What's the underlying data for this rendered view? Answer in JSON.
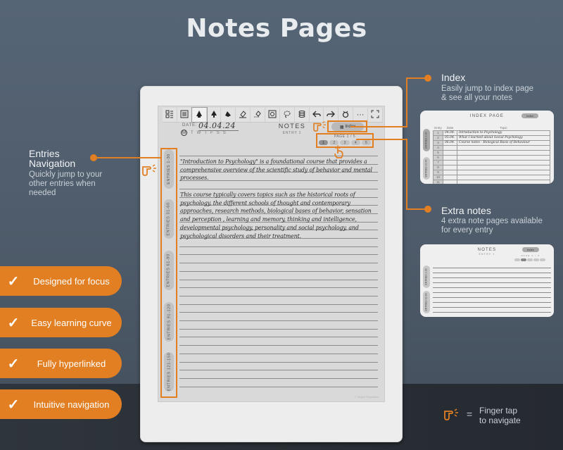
{
  "title": "Notes Pages",
  "device": {
    "toolbar": [
      {
        "icon": "layout-grid-icon"
      },
      {
        "icon": "list-icon"
      },
      {
        "icon": "pen-tool-icon",
        "active": true
      },
      {
        "icon": "brush-icon"
      },
      {
        "icon": "marker-icon"
      },
      {
        "icon": "eraser-icon"
      },
      {
        "icon": "selection-eraser-icon"
      },
      {
        "icon": "screenshot-icon"
      },
      {
        "icon": "lasso-icon"
      },
      {
        "icon": "layers-icon"
      },
      {
        "icon": "undo-icon"
      },
      {
        "icon": "redo-icon"
      },
      {
        "icon": "ai-assistant-icon"
      },
      {
        "icon": "more-icon",
        "glyph": "···"
      },
      {
        "icon": "fullscreen-icon"
      }
    ],
    "date_label": "DATE:",
    "date_value": "04.04.24",
    "weekdays": [
      "M",
      "T",
      "W",
      "T",
      "F",
      "S",
      "S"
    ],
    "notes_title": "NOTES",
    "entry_label": "ENTRY 1",
    "index_button": "Index",
    "page_label": "PAGE 1 / 5",
    "pages": [
      "1",
      "2",
      "3",
      "4",
      "5"
    ],
    "current_page": 1,
    "side_tabs": [
      "ENTRIES 1-30",
      "ENTRIES 31-60",
      "ENTRIES 61-90",
      "ENTRIES 91-120",
      "ENTRIES 121-150"
    ],
    "paragraphs": [
      "\"Introduction to Psychology\" is a foundational course that provides a comprehensive overview of the scientific study of behavior and mental processes.",
      "This course typically covers topics such as the historical roots of psychology, the different schools of thought and contemporary approaches, research methods, biological bases of behavior, sensation and perception , learning and memory, thinking and intelligence, developmental psychology, personality and social psychology, and psychological disorders and their treatment."
    ],
    "copyright": "© Digital Templates"
  },
  "annotations": {
    "entries_nav": {
      "title_line1": "Entries",
      "title_line2": "Navigation",
      "desc": [
        "Quickly jump to your",
        "other entries when",
        "needed"
      ]
    },
    "index": {
      "title": "Index",
      "desc": [
        "Easily jump to index page",
        "& see all your notes"
      ]
    },
    "extra_notes": {
      "title": "Extra notes",
      "desc": [
        "4 extra note pages available",
        "for every entry"
      ]
    }
  },
  "index_preview": {
    "title": "INDEX PAGE",
    "button": "Index",
    "headers": [
      "Entry",
      "Date",
      "Topic"
    ],
    "rows": [
      {
        "n": "1",
        "date": "04.04.",
        "topic": "Introduction to Psychology"
      },
      {
        "n": "2",
        "date": "05.04.",
        "topic": "What I learned about Social Psychology"
      },
      {
        "n": "3",
        "date": "06.04.",
        "topic": "Course notes - Biological Basis of Behaviour"
      },
      {
        "n": "4",
        "date": "",
        "topic": ""
      },
      {
        "n": "5",
        "date": "",
        "topic": ""
      },
      {
        "n": "6",
        "date": "",
        "topic": ""
      },
      {
        "n": "7",
        "date": "",
        "topic": ""
      },
      {
        "n": "8",
        "date": "",
        "topic": ""
      },
      {
        "n": "9",
        "date": "",
        "topic": ""
      },
      {
        "n": "10",
        "date": "",
        "topic": ""
      },
      {
        "n": "11",
        "date": "",
        "topic": ""
      }
    ],
    "side_tabs": [
      "ENTRIES 1-30",
      "ENTRIES 31-60"
    ]
  },
  "notes_preview": {
    "title": "NOTES",
    "entry": "ENTRY 1",
    "button": "Index",
    "page_label": "PAGE 2 / 5",
    "side_tabs": [
      "ENTRIES 1-30",
      "ENTRIES 31-60"
    ]
  },
  "features": [
    "Designed for focus",
    "Easy learning curve",
    "Fully hyperlinked",
    "Intuitive navigation"
  ],
  "legend": {
    "equals": "=",
    "line1": "Finger tap",
    "line2": "to navigate"
  },
  "colors": {
    "accent": "#e27f22",
    "background": "#566576",
    "dark_band": "#2b3036",
    "device": "#ededed"
  }
}
